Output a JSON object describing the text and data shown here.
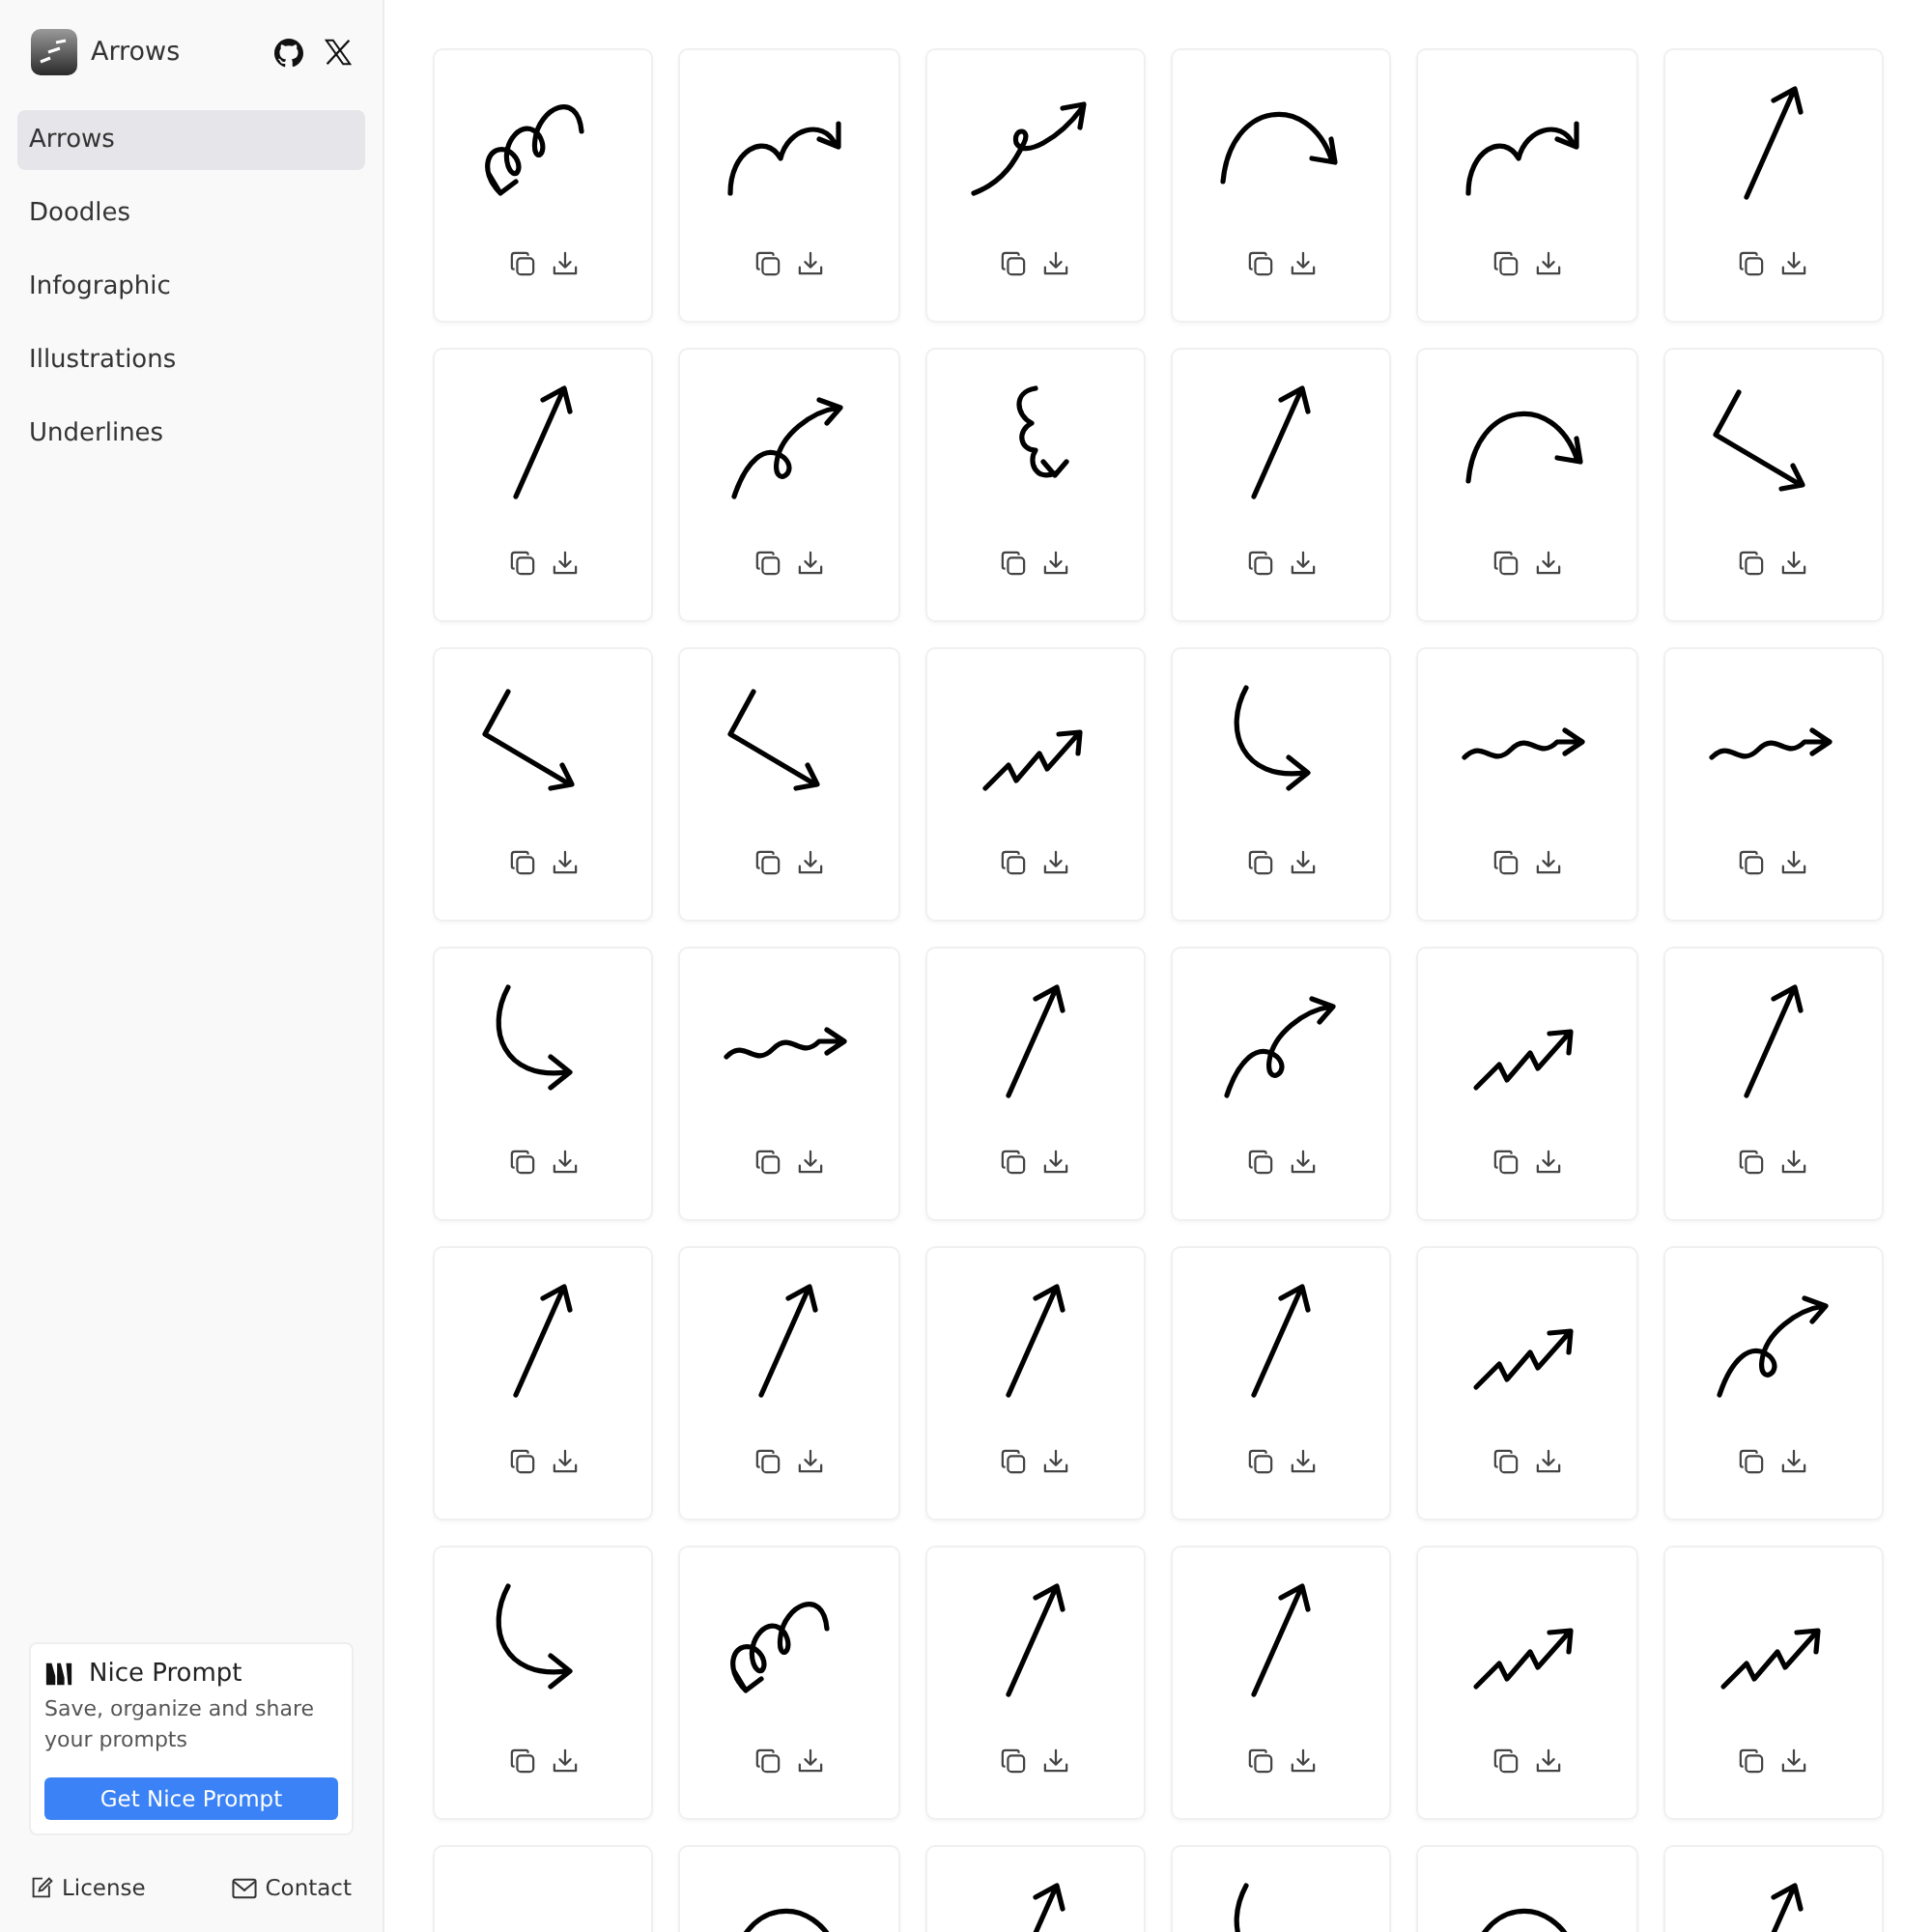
{
  "brand": {
    "name": "Arrows"
  },
  "nav": [
    {
      "label": "Arrows",
      "selected": true
    },
    {
      "label": "Doodles",
      "selected": false
    },
    {
      "label": "Infographic",
      "selected": false
    },
    {
      "label": "Illustrations",
      "selected": false
    },
    {
      "label": "Underlines",
      "selected": false
    }
  ],
  "promo": {
    "title": "Nice Prompt",
    "description": "Save, organize and share your prompts",
    "button": "Get Nice Prompt"
  },
  "footer_links": [
    {
      "label": "License",
      "kind": "license"
    },
    {
      "label": "Contact",
      "kind": "contact"
    }
  ],
  "cards": [
    {
      "kind": "spiral"
    },
    {
      "kind": "hump"
    },
    {
      "kind": "loop"
    },
    {
      "kind": "arc"
    },
    {
      "kind": "hump"
    },
    {
      "kind": "straight"
    },
    {
      "kind": "straight"
    },
    {
      "kind": "curl"
    },
    {
      "kind": "squiggle"
    },
    {
      "kind": "straight"
    },
    {
      "kind": "arc"
    },
    {
      "kind": "bent"
    },
    {
      "kind": "bent"
    },
    {
      "kind": "bent"
    },
    {
      "kind": "zigzag"
    },
    {
      "kind": "hook"
    },
    {
      "kind": "wave"
    },
    {
      "kind": "wave"
    },
    {
      "kind": "hook"
    },
    {
      "kind": "wave"
    },
    {
      "kind": "straight"
    },
    {
      "kind": "curl"
    },
    {
      "kind": "zigzag"
    },
    {
      "kind": "straight"
    },
    {
      "kind": "straight"
    },
    {
      "kind": "straight"
    },
    {
      "kind": "straight"
    },
    {
      "kind": "straight"
    },
    {
      "kind": "zigzag"
    },
    {
      "kind": "curl"
    },
    {
      "kind": "hook"
    },
    {
      "kind": "spiral"
    },
    {
      "kind": "straight"
    },
    {
      "kind": "straight"
    },
    {
      "kind": "zigzag"
    },
    {
      "kind": "zigzag"
    },
    {
      "kind": "blank"
    },
    {
      "kind": "arc"
    },
    {
      "kind": "straight"
    },
    {
      "kind": "hook"
    },
    {
      "kind": "arc"
    },
    {
      "kind": "straight"
    }
  ]
}
